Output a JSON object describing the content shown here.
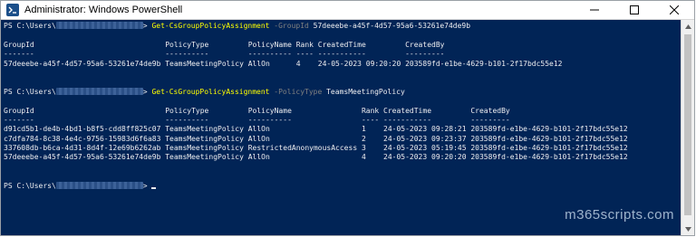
{
  "window": {
    "title": "Administrator: Windows PowerShell",
    "controls": [
      "minimize",
      "maximize",
      "close"
    ]
  },
  "console": {
    "block1": {
      "prompt_prefix": "PS C:\\Users\\",
      "prompt_suffix": "> ",
      "cmdlet": "Get-CsGroupPolicyAssignment",
      "param": " -GroupId ",
      "arg": "57deeebe-a45f-4d57-95a6-53261e74de9b",
      "headers": [
        "GroupId",
        "PolicyType",
        "PolicyName",
        "Rank",
        "CreatedTime",
        "CreatedBy"
      ],
      "rows": [
        [
          "57deeebe-a45f-4d57-95a6-53261e74de9b",
          "TeamsMeetingPolicy",
          "AllOn",
          "4",
          "24-05-2023 09:20:20",
          "203589fd-e1be-4629-b101-2f17bdc55e12"
        ]
      ]
    },
    "block2": {
      "prompt_prefix": "PS C:\\Users\\",
      "prompt_suffix": "> ",
      "cmdlet": "Get-CsGroupPolicyAssignment",
      "param": " -PolicyType ",
      "arg": "TeamsMeetingPolicy",
      "headers": [
        "GroupId",
        "PolicyType",
        "PolicyName",
        "Rank",
        "CreatedTime",
        "CreatedBy"
      ],
      "rows": [
        [
          "d91cd5b1-de4b-4bd1-b8f5-cdd8ff825c07",
          "TeamsMeetingPolicy",
          "AllOn",
          "1",
          "24-05-2023 09:28:21",
          "203589fd-e1be-4629-b101-2f17bdc55e12"
        ],
        [
          "c7dfa784-8c38-4e4c-9756-15983d6f6a83",
          "TeamsMeetingPolicy",
          "AllOn",
          "2",
          "24-05-2023 09:23:37",
          "203589fd-e1be-4629-b101-2f17bdc55e12"
        ],
        [
          "337608db-b6ca-4d31-8d4f-12e69b6262ab",
          "TeamsMeetingPolicy",
          "RestrictedAnonymousAccess",
          "3",
          "24-05-2023 05:19:45",
          "203589fd-e1be-4629-b101-2f17bdc55e12"
        ],
        [
          "57deeebe-a45f-4d57-95a6-53261e74de9b",
          "TeamsMeetingPolicy",
          "AllOn",
          "4",
          "24-05-2023 09:20:20",
          "203589fd-e1be-4629-b101-2f17bdc55e12"
        ]
      ]
    },
    "final_prompt": {
      "prefix": "PS C:\\Users\\",
      "suffix": "> "
    }
  },
  "watermark": "m365scripts.com",
  "colors": {
    "background": "#012456",
    "text": "#eeedf0",
    "cmdlet": "#ffff00",
    "parameter": "#808080"
  }
}
